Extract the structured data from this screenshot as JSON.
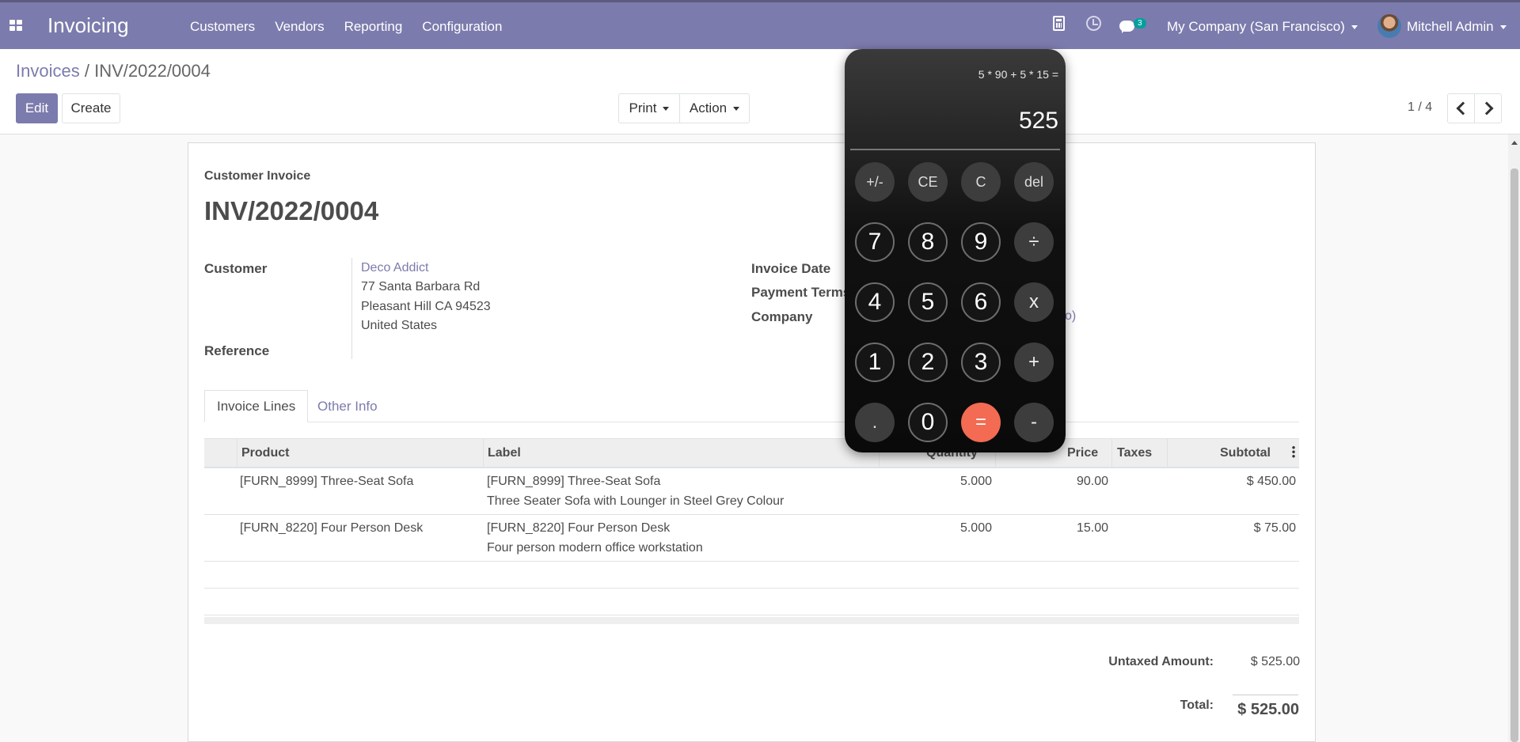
{
  "topbar": {
    "app_title": "Invoicing",
    "menu": [
      "Customers",
      "Vendors",
      "Reporting",
      "Configuration"
    ],
    "chat_count": "3",
    "company": "My Company (San Francisco)",
    "user": "Mitchell Admin"
  },
  "control": {
    "breadcrumb_parent": "Invoices",
    "breadcrumb_sep": "/",
    "breadcrumb_current": "INV/2022/0004",
    "edit": "Edit",
    "create": "Create",
    "print": "Print",
    "action": "Action",
    "pager": "1 / 4"
  },
  "invoice": {
    "type_label": "Customer Invoice",
    "number": "INV/2022/0004",
    "customer_label": "Customer",
    "customer_name": "Deco Addict",
    "address": [
      "77 Santa Barbara Rd",
      "Pleasant Hill CA 94523",
      "United States"
    ],
    "reference_label": "Reference",
    "invoice_date_label": "Invoice Date",
    "payment_terms_label": "Payment Terms",
    "company_label": "Company",
    "company_partial": "o)"
  },
  "tabs": [
    "Invoice Lines",
    "Other Info"
  ],
  "lines": {
    "headers": {
      "product": "Product",
      "label": "Label",
      "quantity": "Quantity",
      "price": "Price",
      "taxes": "Taxes",
      "subtotal": "Subtotal"
    },
    "rows": [
      {
        "product": "[FURN_8999] Three-Seat Sofa",
        "label_1": "[FURN_8999] Three-Seat Sofa",
        "label_2": "Three Seater Sofa with Lounger in Steel Grey Colour",
        "quantity": "5.000",
        "price": "90.00",
        "subtotal": "$ 450.00"
      },
      {
        "product": "[FURN_8220] Four Person Desk",
        "label_1": "[FURN_8220] Four Person Desk",
        "label_2": "Four person modern office workstation",
        "quantity": "5.000",
        "price": "15.00",
        "subtotal": "$ 75.00"
      }
    ]
  },
  "totals": {
    "untaxed_label": "Untaxed Amount:",
    "untaxed_value": "$ 525.00",
    "total_label": "Total:",
    "total_value": "$ 525.00"
  },
  "calculator": {
    "expression": "5 * 90 + 5 * 15 =",
    "result": "525",
    "keys": [
      [
        "+/-",
        "CE",
        "C",
        "del"
      ],
      [
        "7",
        "8",
        "9",
        "÷"
      ],
      [
        "4",
        "5",
        "6",
        "x"
      ],
      [
        "1",
        "2",
        "3",
        "+"
      ],
      [
        ".",
        "0",
        "=",
        "-"
      ]
    ],
    "equals_color": "#f26b52"
  },
  "colors": {
    "brand": "#7c7bad",
    "badge": "#00a09d"
  }
}
